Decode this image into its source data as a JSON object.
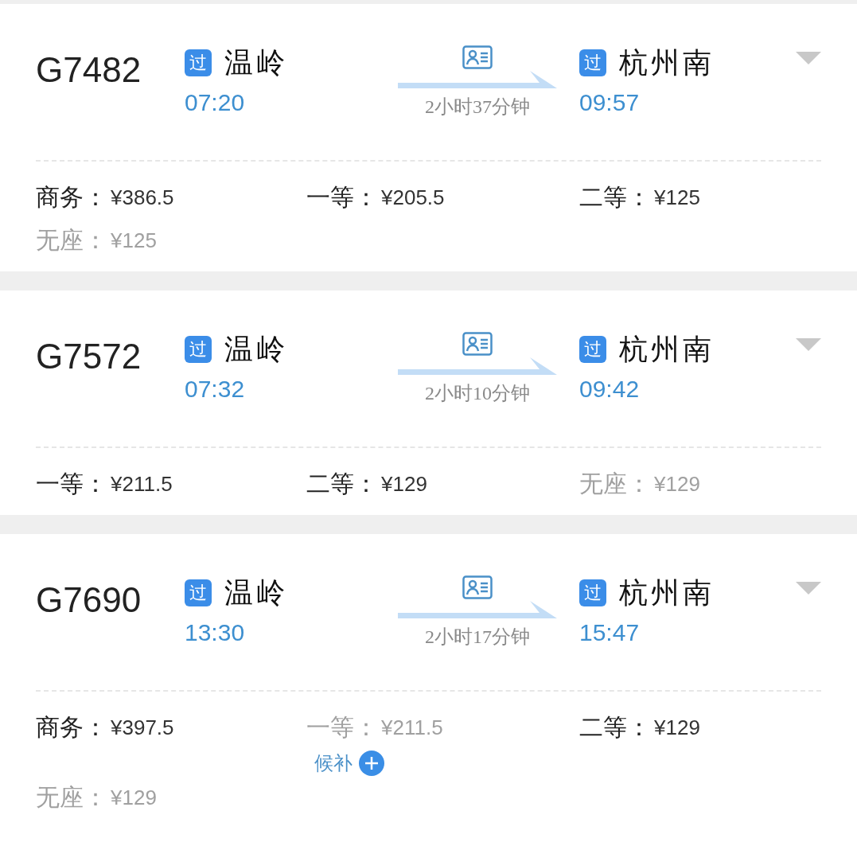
{
  "trains": [
    {
      "number": "G7482",
      "from": {
        "badge": "过",
        "station": "温岭",
        "time": "07:20"
      },
      "duration": "2小时37分钟",
      "to": {
        "badge": "过",
        "station": "杭州南",
        "time": "09:57"
      },
      "seats": [
        {
          "label": "商务：",
          "price": "¥386.5",
          "available": true
        },
        {
          "label": "一等：",
          "price": "¥205.5",
          "available": true
        },
        {
          "label": "二等：",
          "price": "¥125",
          "available": true
        },
        {
          "label": "无座：",
          "price": "¥125",
          "available": false
        }
      ]
    },
    {
      "number": "G7572",
      "from": {
        "badge": "过",
        "station": "温岭",
        "time": "07:32"
      },
      "duration": "2小时10分钟",
      "to": {
        "badge": "过",
        "station": "杭州南",
        "time": "09:42"
      },
      "seats": [
        {
          "label": "一等：",
          "price": "¥211.5",
          "available": true
        },
        {
          "label": "二等：",
          "price": "¥129",
          "available": true
        },
        {
          "label": "无座：",
          "price": "¥129",
          "available": false
        }
      ]
    },
    {
      "number": "G7690",
      "from": {
        "badge": "过",
        "station": "温岭",
        "time": "13:30"
      },
      "duration": "2小时17分钟",
      "to": {
        "badge": "过",
        "station": "杭州南",
        "time": "15:47"
      },
      "seats": [
        {
          "label": "商务：",
          "price": "¥397.5",
          "available": true
        },
        {
          "label": "一等：",
          "price": "¥211.5",
          "available": false,
          "waitlist": "候补"
        },
        {
          "label": "二等：",
          "price": "¥129",
          "available": true
        },
        {
          "label": "无座：",
          "price": "¥129",
          "available": false
        }
      ]
    }
  ]
}
